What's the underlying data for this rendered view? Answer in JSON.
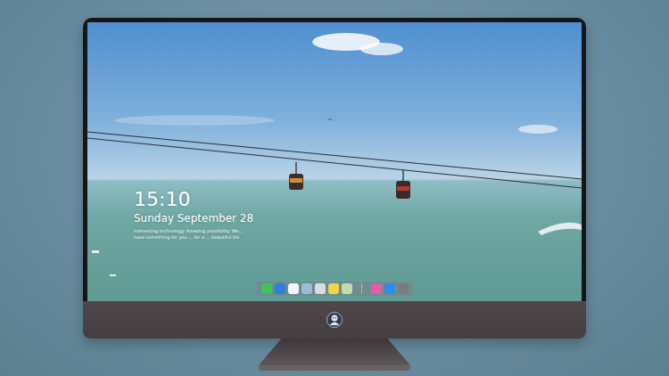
{
  "lock_screen": {
    "time": "15:10",
    "date": "Sunday September 28",
    "caption": [
      "Interesting technology. Amazing possibility. We...",
      "have something for you ... for a ... beautiful life"
    ]
  }
}
